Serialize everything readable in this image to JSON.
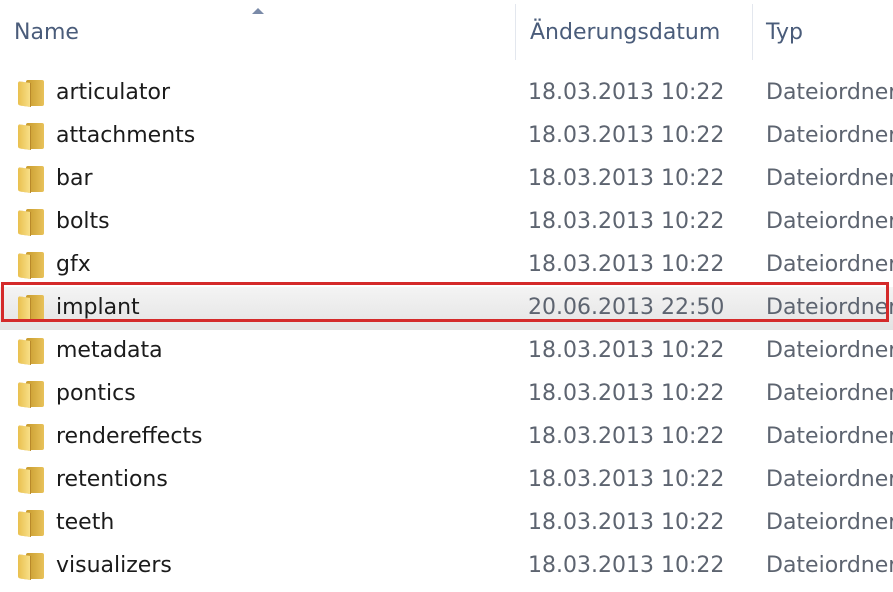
{
  "columns": {
    "name": "Name",
    "date": "Änderungsdatum",
    "type": "Typ"
  },
  "rows": [
    {
      "name": "articulator",
      "date": "18.03.2013 10:22",
      "type": "Dateiordner",
      "icon": "folder-icon"
    },
    {
      "name": "attachments",
      "date": "18.03.2013 10:22",
      "type": "Dateiordner",
      "icon": "folder-icon"
    },
    {
      "name": "bar",
      "date": "18.03.2013 10:22",
      "type": "Dateiordner",
      "icon": "folder-icon"
    },
    {
      "name": "bolts",
      "date": "18.03.2013 10:22",
      "type": "Dateiordner",
      "icon": "folder-icon"
    },
    {
      "name": "gfx",
      "date": "18.03.2013 10:22",
      "type": "Dateiordner",
      "icon": "folder-icon"
    },
    {
      "name": "implant",
      "date": "20.06.2013 22:50",
      "type": "Dateiordner",
      "icon": "folder-icon",
      "selected": true
    },
    {
      "name": "metadata",
      "date": "18.03.2013 10:22",
      "type": "Dateiordner",
      "icon": "folder-icon"
    },
    {
      "name": "pontics",
      "date": "18.03.2013 10:22",
      "type": "Dateiordner",
      "icon": "folder-icon"
    },
    {
      "name": "rendereffects",
      "date": "18.03.2013 10:22",
      "type": "Dateiordner",
      "icon": "folder-icon"
    },
    {
      "name": "retentions",
      "date": "18.03.2013 10:22",
      "type": "Dateiordner",
      "icon": "folder-icon"
    },
    {
      "name": "teeth",
      "date": "18.03.2013 10:22",
      "type": "Dateiordner",
      "icon": "folder-icon"
    },
    {
      "name": "visualizers",
      "date": "18.03.2013 10:22",
      "type": "Dateiordner",
      "icon": "folder-icon"
    }
  ],
  "colors": {
    "header_text": "#4a5c7a",
    "highlight_border": "#d42a2a",
    "folder": "#e8c25a"
  }
}
